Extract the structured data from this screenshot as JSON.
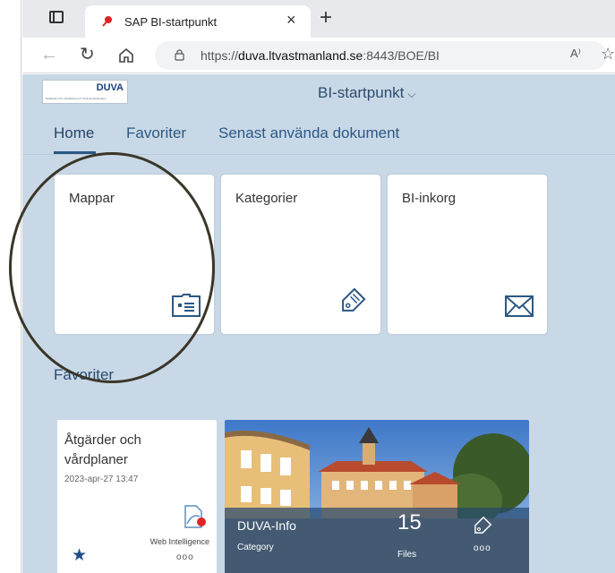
{
  "browser": {
    "tab_title": "SAP BI-startpunkt",
    "tab_close": "×",
    "new_tab": "+",
    "url_prefix": "https://",
    "url_host": "duva.ltvastmanland.se",
    "url_path": ":8443/BOE/BI",
    "read_aloud": "A⁾"
  },
  "header": {
    "logo_title": "DUVA",
    "logo_subtitle": "Databasen för Uppföljning och Verksamhetsanalys",
    "app_title": "BI-startpunkt",
    "app_title_chevron": "⌵"
  },
  "nav": {
    "tabs": [
      {
        "label": "Home"
      },
      {
        "label": "Favoriter"
      },
      {
        "label": "Senast använda dokument"
      }
    ]
  },
  "tiles": [
    {
      "label": "Mappar",
      "icon": "folder-card-icon"
    },
    {
      "label": "Kategorier",
      "icon": "tag-icon"
    },
    {
      "label": "BI-inkorg",
      "icon": "envelope-icon"
    }
  ],
  "favorites": {
    "section_title": "Favoriter",
    "doc": {
      "title": "Åtgärder och vårdplaner",
      "date": "2023-apr-27 13:47",
      "type": "Web Intelligence",
      "star": "★",
      "more": "ooo"
    },
    "category": {
      "name": "DUVA-Info",
      "type": "Category",
      "count": "15",
      "count_label": "Files",
      "more": "ooo"
    }
  },
  "colors": {
    "accent": "#2b5886",
    "page_bg": "#c9d8e6",
    "annotation": "#3a3628"
  }
}
